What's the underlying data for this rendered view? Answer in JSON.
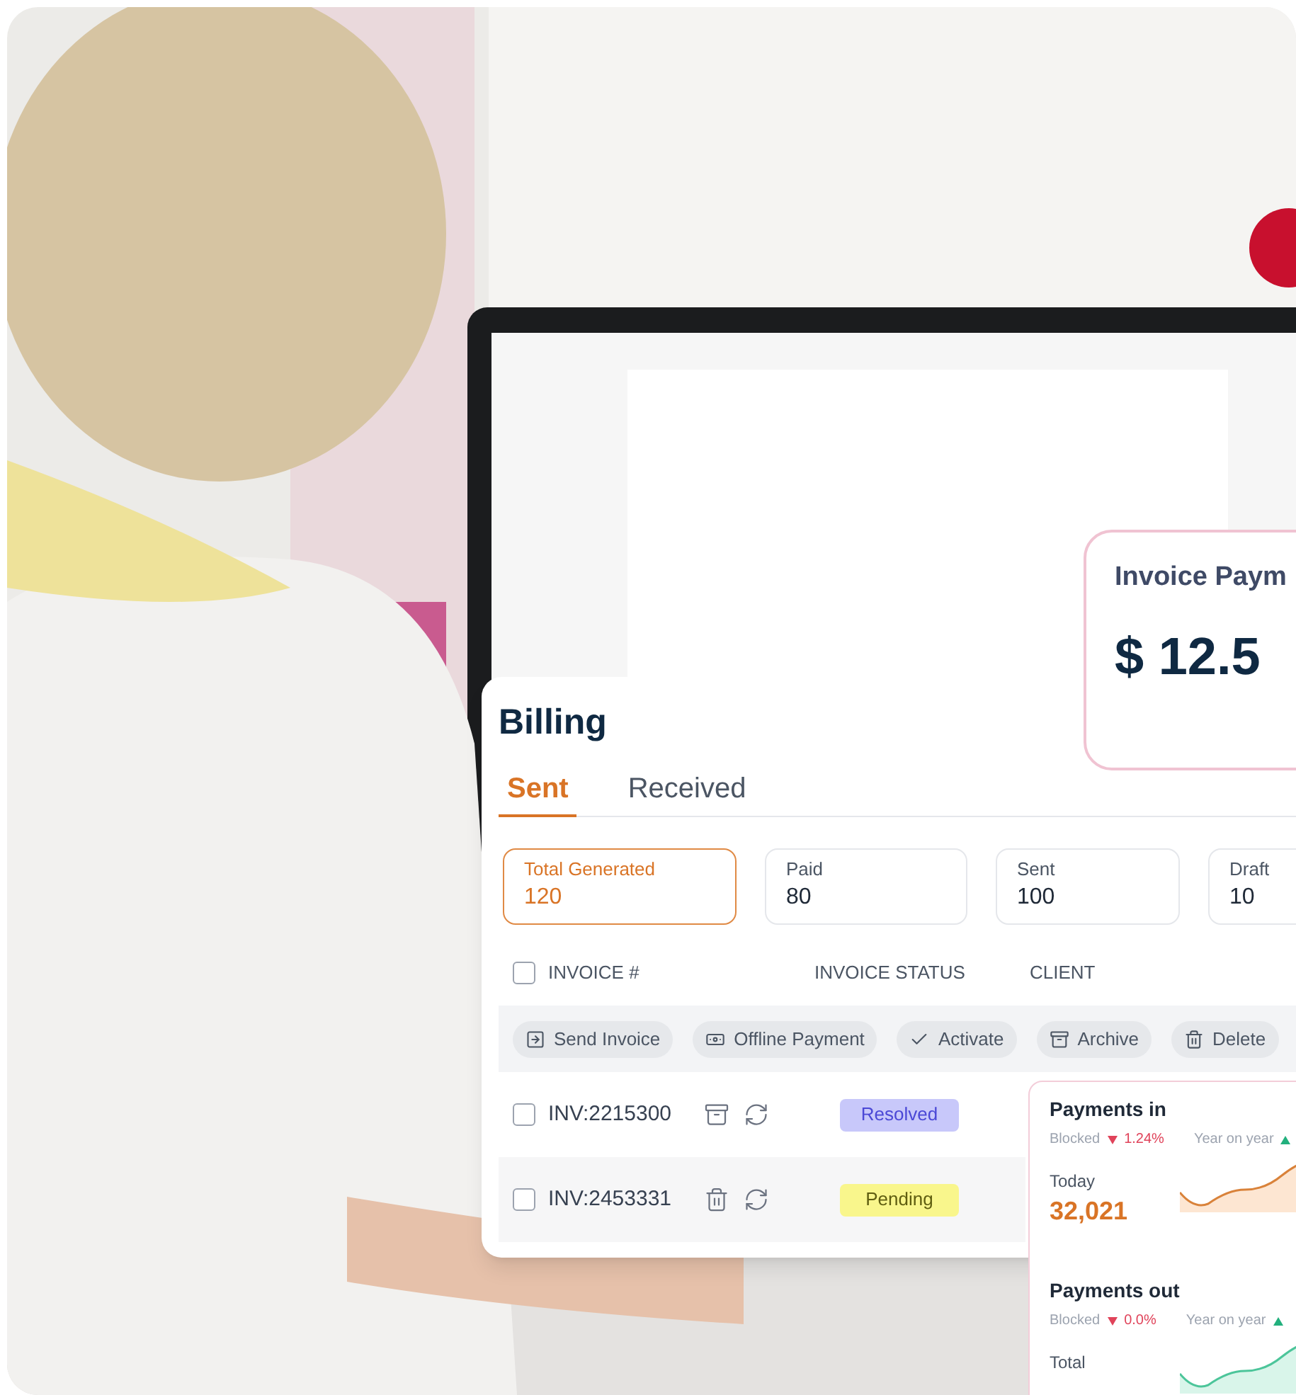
{
  "invoice_payment_card": {
    "title": "Invoice Paym",
    "amount": "$ 12.5"
  },
  "billing": {
    "title": "Billing",
    "tabs": [
      {
        "label": "Sent",
        "selected": true
      },
      {
        "label": "Received",
        "selected": false
      }
    ],
    "stats": [
      {
        "label": "Total Generated",
        "value": "120",
        "selected": true
      },
      {
        "label": "Paid",
        "value": "80",
        "selected": false
      },
      {
        "label": "Sent",
        "value": "100",
        "selected": false
      },
      {
        "label": "Draft",
        "value": "10",
        "selected": false
      }
    ],
    "table": {
      "select_all": {
        "checked": false
      },
      "columns": [
        "INVOICE #",
        "INVOICE STATUS",
        "CLIENT"
      ],
      "actions": [
        {
          "label": "Send Invoice",
          "kind": "send"
        },
        {
          "label": "Offline Payment",
          "kind": "offline"
        },
        {
          "label": "Activate",
          "kind": "activate"
        },
        {
          "label": "Archive",
          "kind": "archive"
        },
        {
          "label": "Delete",
          "kind": "delete"
        }
      ],
      "rows": [
        {
          "checked": false,
          "invoice": "INV:2215300",
          "kind": "archive",
          "status": {
            "label": "Resolved",
            "kind": "resolved",
            "color": "#c8c8fa"
          }
        },
        {
          "checked": false,
          "invoice": "INV:2453331",
          "kind": "delete",
          "status": {
            "label": "Pending",
            "kind": "pending",
            "color": "#f9f68c"
          }
        }
      ]
    }
  },
  "payments": [
    {
      "title": "Payments in",
      "kind": "in",
      "blocked_label": "Blocked",
      "blocked_change": "1.24%",
      "yoy_label": "Year on year",
      "metric_label": "Today",
      "metric_value": "32,021"
    },
    {
      "title": "Payments out",
      "kind": "out",
      "blocked_label": "Blocked",
      "blocked_change": "0.0%",
      "yoy_label": "Year on year",
      "metric_label": "Total"
    }
  ]
}
